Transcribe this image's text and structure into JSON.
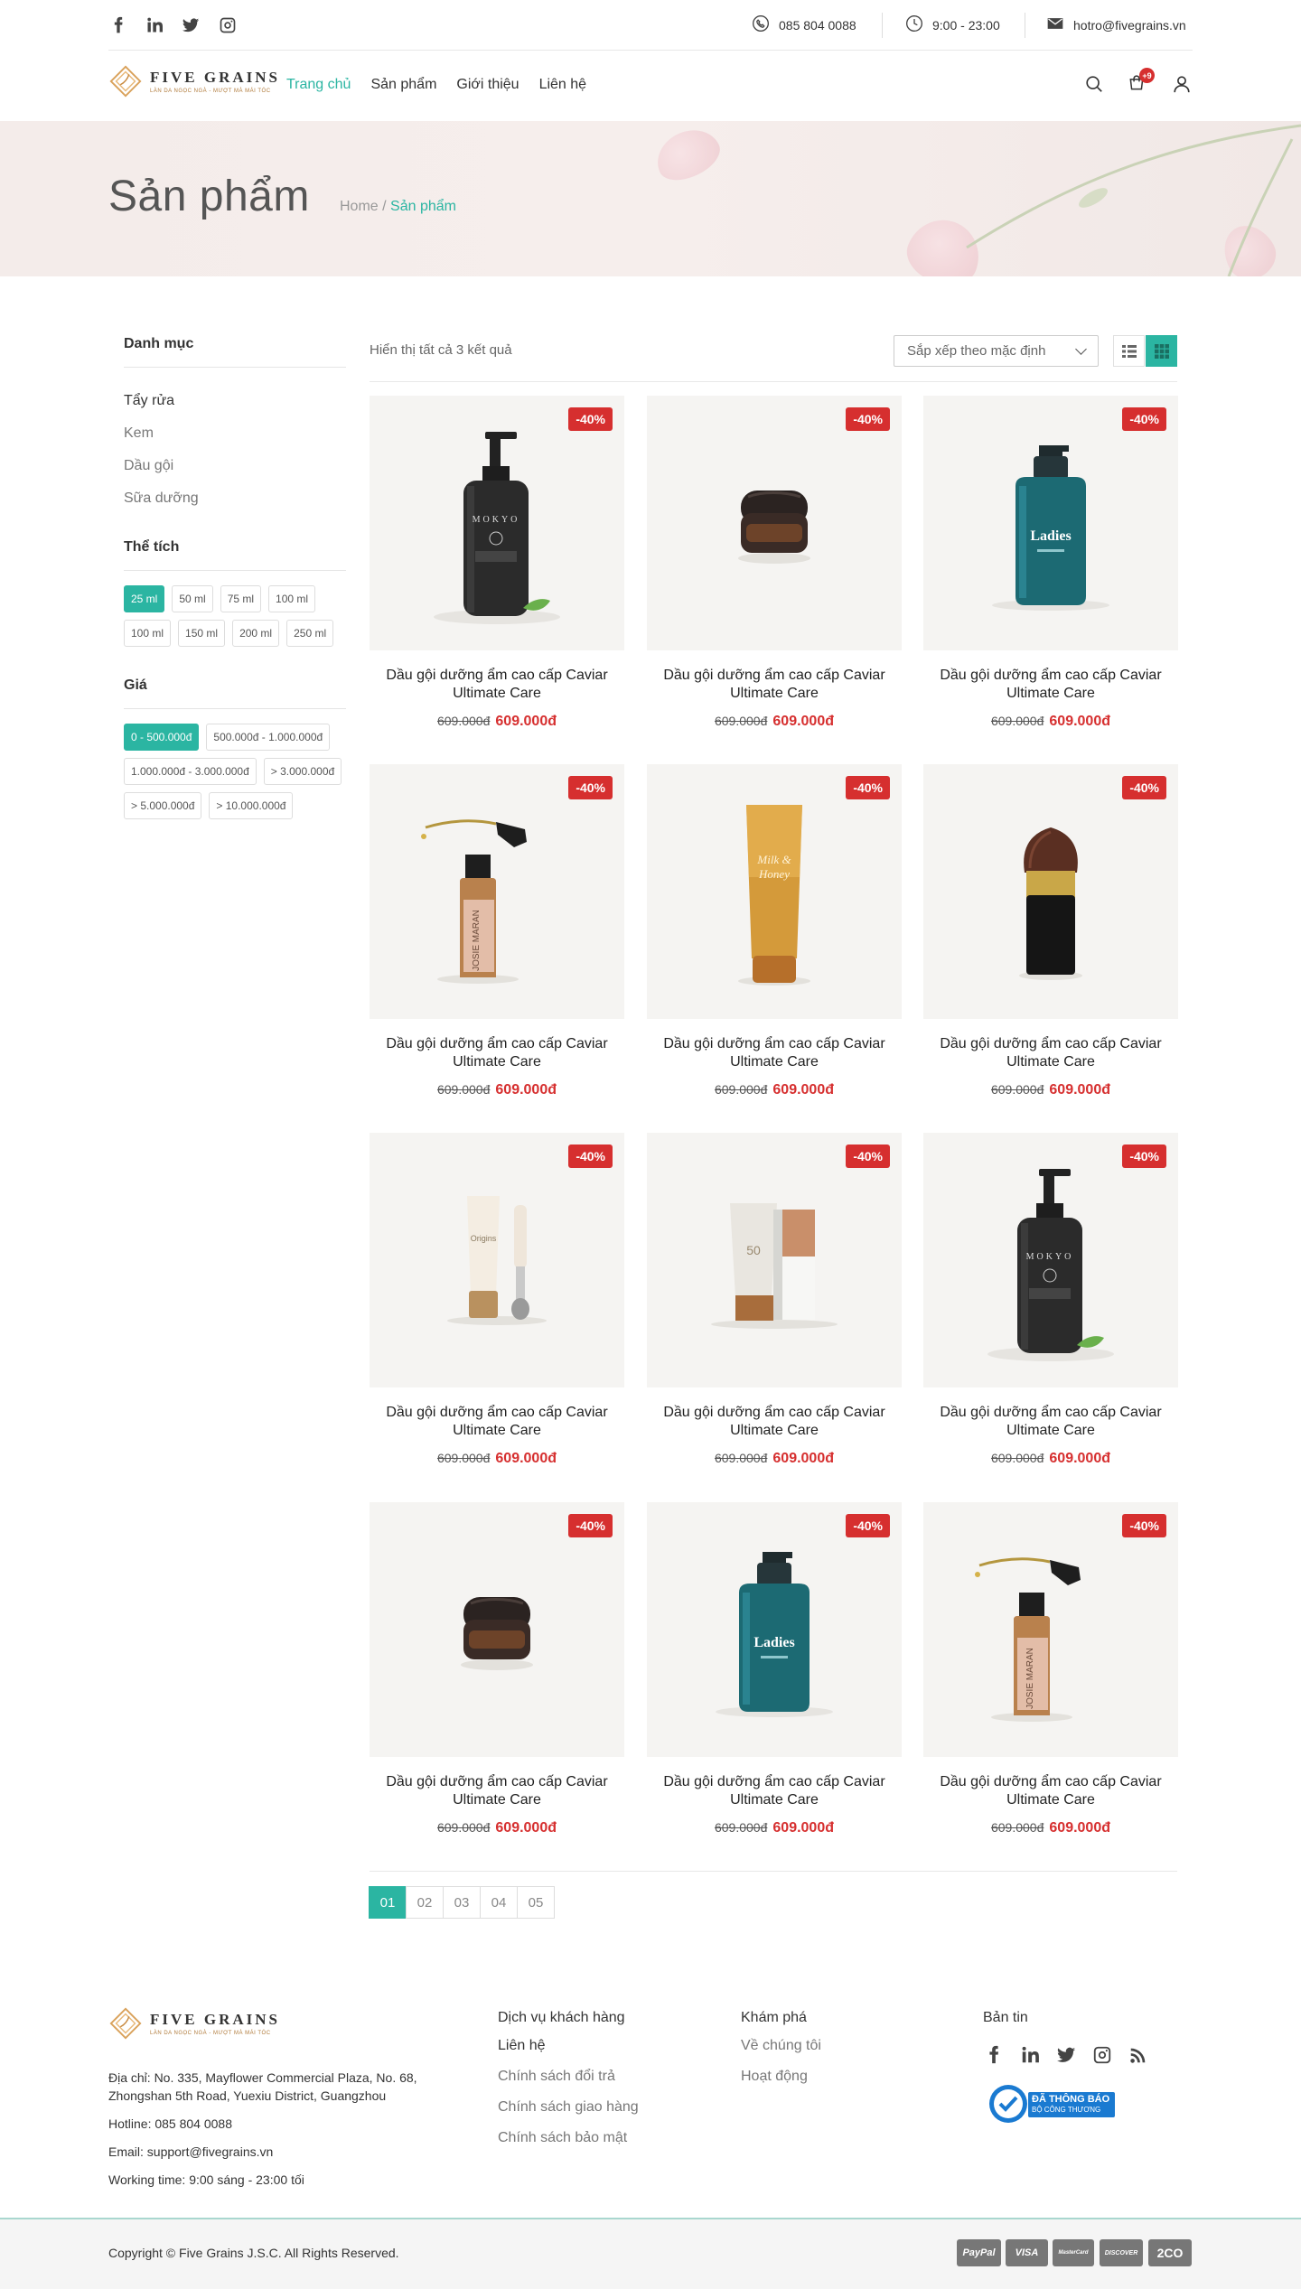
{
  "topbar": {
    "social": [
      "facebook-icon",
      "linkedin-icon",
      "twitter-icon",
      "instagram-icon"
    ],
    "phone": "085 804 0088",
    "hours": "9:00 - 23:00",
    "email": "hotro@fivegrains.vn"
  },
  "brand": {
    "name": "FIVE GRAINS",
    "tagline": "LÀN DA NGỌC NGÀ - MƯỢT MÀ MÁI TÓC",
    "accent": "#2bb5a2",
    "sale": "#d62f2f"
  },
  "nav": {
    "items": [
      "Trang chủ",
      "Sản phẩm",
      "Giới thiệu",
      "Liên hệ"
    ],
    "active": 0
  },
  "header": {
    "cart_count": "+9"
  },
  "banner": {
    "title": "Sản phẩm",
    "crumb_home": "Home",
    "crumb_sep": " / ",
    "crumb_current": "Sản phẩm"
  },
  "sidebar": {
    "cat_title": "Danh mục",
    "categories": [
      "Tẩy rửa",
      "Kem",
      "Dầu gội",
      "Sữa dưỡng"
    ],
    "volume_title": "Thể tích",
    "volumes": [
      "25 ml",
      "50 ml",
      "75 ml",
      "100 ml",
      "100 ml",
      "150 ml",
      "200 ml",
      "250 ml"
    ],
    "price_title": "Giá",
    "prices": [
      "0 - 500.000đ",
      "500.000đ - 1.000.000đ",
      "1.000.000đ - 3.000.000đ",
      "> 3.000.000đ",
      "> 5.000.000đ",
      "> 10.000.000đ"
    ]
  },
  "toolbar": {
    "result_text": "Hiển thị tất cả 3 kết quả",
    "sort_label": "Sắp xếp theo mặc định"
  },
  "products": [
    {
      "name_l1": "Dầu gội dưỡng ẩm cao cấp Caviar",
      "name_l2": "Ultimate Care",
      "old": "609.000đ",
      "new": "609.000đ",
      "discount": "-40%",
      "img": "pump-black"
    },
    {
      "name_l1": "Dầu gội dưỡng ẩm cao cấp Caviar",
      "name_l2": "Ultimate Care",
      "old": "609.000đ",
      "new": "609.000đ",
      "discount": "-40%",
      "img": "jar"
    },
    {
      "name_l1": "Dầu gội dưỡng ẩm cao cấp Caviar",
      "name_l2": "Ultimate Care",
      "old": "609.000đ",
      "new": "609.000đ",
      "discount": "-40%",
      "img": "teal-bottle"
    },
    {
      "name_l1": "Dầu gội dưỡng ẩm cao cấp Caviar",
      "name_l2": "Ultimate Care",
      "old": "609.000đ",
      "new": "609.000đ",
      "discount": "-40%",
      "img": "dropper"
    },
    {
      "name_l1": "Dầu gội dưỡng ẩm cao cấp Caviar",
      "name_l2": "Ultimate Care",
      "old": "609.000đ",
      "new": "609.000đ",
      "discount": "-40%",
      "img": "tube-gold"
    },
    {
      "name_l1": "Dầu gội dưỡng ẩm cao cấp Caviar",
      "name_l2": "Ultimate Care",
      "old": "609.000đ",
      "new": "609.000đ",
      "discount": "-40%",
      "img": "brush"
    },
    {
      "name_l1": "Dầu gội dưỡng ẩm cao cấp Caviar",
      "name_l2": "Ultimate Care",
      "old": "609.000đ",
      "new": "609.000đ",
      "discount": "-40%",
      "img": "tube-roller"
    },
    {
      "name_l1": "Dầu gội dưỡng ẩm cao cấp Caviar",
      "name_l2": "Ultimate Care",
      "old": "609.000đ",
      "new": "609.000đ",
      "discount": "-40%",
      "img": "sunscreen"
    },
    {
      "name_l1": "Dầu gội dưỡng ẩm cao cấp Caviar",
      "name_l2": "Ultimate Care",
      "old": "609.000đ",
      "new": "609.000đ",
      "discount": "-40%",
      "img": "pump-black"
    },
    {
      "name_l1": "Dầu gội dưỡng ẩm cao cấp Caviar",
      "name_l2": "Ultimate Care",
      "old": "609.000đ",
      "new": "609.000đ",
      "discount": "-40%",
      "img": "jar"
    },
    {
      "name_l1": "Dầu gội dưỡng ẩm cao cấp Caviar",
      "name_l2": "Ultimate Care",
      "old": "609.000đ",
      "new": "609.000đ",
      "discount": "-40%",
      "img": "teal-bottle"
    },
    {
      "name_l1": "Dầu gội dưỡng ẩm cao cấp Caviar",
      "name_l2": "Ultimate Care",
      "old": "609.000đ",
      "new": "609.000đ",
      "discount": "-40%",
      "img": "dropper"
    }
  ],
  "pagination": {
    "pages": [
      "01",
      "02",
      "03",
      "04",
      "05"
    ],
    "active": 0
  },
  "footer": {
    "address": "Địa chỉ: No. 335, Mayflower Commercial Plaza, No. 68, Zhongshan 5th Road, Yuexiu District, Guangzhou",
    "hotline": "Hotline: 085 804 0088",
    "email": "Email: support@fivegrains.vn",
    "working": "Working time: 9:00 sáng - 23:00 tối",
    "col1_title": "Dịch vụ khách hàng",
    "col1_links": [
      "Liên hệ",
      "Chính sách đổi trả",
      "Chính sách giao hàng",
      "Chính sách bảo mật"
    ],
    "col2_title": "Khám phá",
    "col2_links": [
      "Về chúng tôi",
      "Hoạt động"
    ],
    "col3_title": "Bản tin",
    "col3_social": [
      "facebook-icon",
      "linkedin-icon",
      "twitter-icon",
      "instagram-icon",
      "rss-icon"
    ],
    "bct_l1": "ĐÃ THÔNG BÁO",
    "bct_l2": "BỘ CÔNG THƯƠNG",
    "copyright": "Copyright © Five Grains J.S.C. All Rights Reserved.",
    "payments": [
      "PayPal",
      "VISA",
      "MasterCard",
      "DISCOVER",
      "2CO"
    ]
  }
}
